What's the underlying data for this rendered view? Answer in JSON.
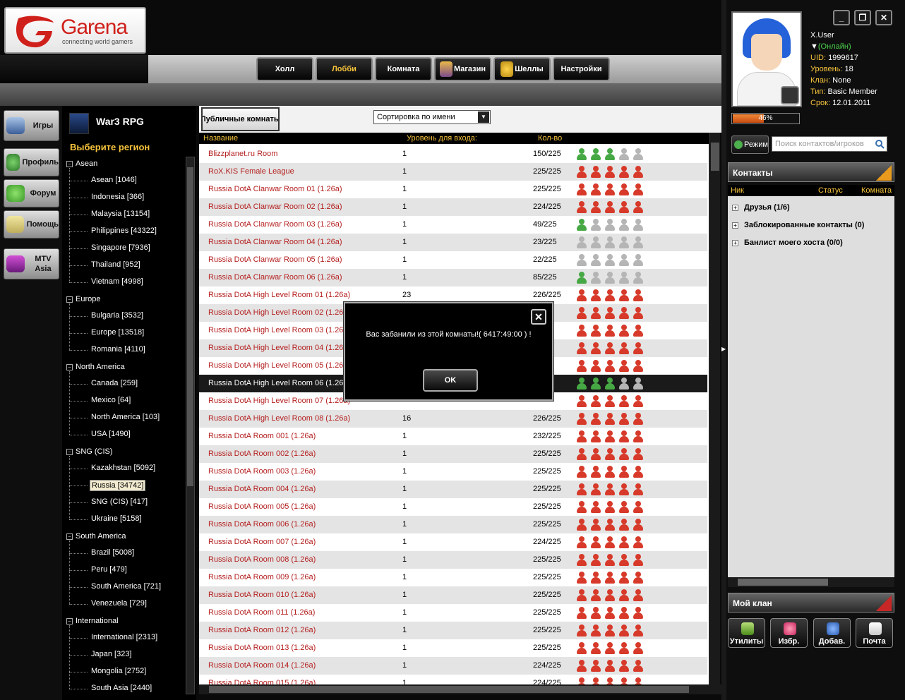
{
  "brand": {
    "name": "Garena",
    "tagline": "connecting world gamers"
  },
  "nav": [
    {
      "label": "Холл",
      "icon": null,
      "active": false
    },
    {
      "label": "Лобби",
      "icon": null,
      "active": true
    },
    {
      "label": "Комната",
      "icon": null,
      "active": false
    },
    {
      "label": "Магазин",
      "icon": "shop-icon",
      "active": false
    },
    {
      "label": "Шеллы",
      "icon": "shells-icon",
      "active": false
    },
    {
      "label": "Настройки",
      "icon": null,
      "active": false
    }
  ],
  "leftnav": [
    {
      "label": "Игры",
      "icon": "gamepad-icon"
    },
    {
      "label": "Профиль",
      "icon": "profile-icon"
    },
    {
      "label": "Форум",
      "icon": "forum-icon"
    },
    {
      "label": "Помощь",
      "icon": "help-icon"
    },
    {
      "label": "MTV Asia",
      "icon": "mtv-icon"
    }
  ],
  "game": {
    "name": "War3 RPG",
    "region_header": "Выберите регион"
  },
  "regions": [
    {
      "group": "Asean",
      "items": [
        "Asean [1046]",
        "Indonesia [366]",
        "Malaysia [13154]",
        "Philippines [43322]",
        "Singapore [7936]",
        "Thailand [952]",
        "Vietnam [4998]"
      ]
    },
    {
      "group": "Europe",
      "items": [
        "Bulgaria [3532]",
        "Europe [13518]",
        "Romania [4110]"
      ]
    },
    {
      "group": "North America",
      "items": [
        "Canada [259]",
        "Mexico [64]",
        "North America [103]",
        "USA [1490]"
      ]
    },
    {
      "group": "SNG (CIS)",
      "items": [
        "Kazakhstan [5092]",
        "Russia [34742]",
        "SNG (CIS) [417]",
        "Ukraine [5158]"
      ]
    },
    {
      "group": "South America",
      "items": [
        "Brazil [5008]",
        "Peru [479]",
        "South America [721]",
        "Venezuela [729]"
      ]
    },
    {
      "group": "International",
      "items": [
        "International [2313]",
        "Japan [323]",
        "Mongolia [2752]",
        "South Asia [2440]"
      ]
    }
  ],
  "selected_region": "Russia [34742]",
  "main": {
    "tab_label": "Публичные комнаты",
    "sort_label": "Сортировка по имени",
    "columns": {
      "name": "Название",
      "level": "Уровень для входа:",
      "count": "Кол-во"
    }
  },
  "rooms": [
    {
      "name": "Blizzplanet.ru Room",
      "level": "1",
      "count": "150/225",
      "icons": "ggg ww"
    },
    {
      "name": "RoX.KIS Female League",
      "level": "1",
      "count": "225/225",
      "icons": "rrrrr"
    },
    {
      "name": "Russia DotA Clanwar Room 01 (1.26a)",
      "level": "1",
      "count": "225/225",
      "icons": "rrrrr"
    },
    {
      "name": "Russia DotA Clanwar Room 02 (1.26a)",
      "level": "1",
      "count": "224/225",
      "icons": "rrrrr"
    },
    {
      "name": "Russia DotA Clanwar Room 03 (1.26a)",
      "level": "1",
      "count": "49/225",
      "icons": "gwwww"
    },
    {
      "name": "Russia DotA Clanwar Room 04 (1.26a)",
      "level": "1",
      "count": "23/225",
      "icons": "wwwww"
    },
    {
      "name": "Russia DotA Clanwar Room 05 (1.26a)",
      "level": "1",
      "count": "22/225",
      "icons": "wwwww"
    },
    {
      "name": "Russia DotA Clanwar Room 06 (1.26a)",
      "level": "1",
      "count": "85/225",
      "icons": "gwwww"
    },
    {
      "name": "Russia DotA High Level Room 01 (1.26a)",
      "level": "23",
      "count": "226/225",
      "icons": "rrrrr"
    },
    {
      "name": "Russia DotA High Level Room 02 (1.26a)",
      "level": "",
      "count": "",
      "icons": "rrrrr"
    },
    {
      "name": "Russia DotA High Level Room 03 (1.26a)",
      "level": "",
      "count": "",
      "icons": "rrrrr"
    },
    {
      "name": "Russia DotA High Level Room 04 (1.26a)",
      "level": "",
      "count": "",
      "icons": "rrrrr"
    },
    {
      "name": "Russia DotA High Level Room 05 (1.26a)",
      "level": "",
      "count": "",
      "icons": "rrrrr"
    },
    {
      "name": "Russia DotA High Level Room 06 (1.26a)",
      "level": "",
      "count": "",
      "icons": "gggww"
    },
    {
      "name": "Russia DotA High Level Room 07 (1.26a)",
      "level": "",
      "count": "",
      "icons": "rrrrr"
    },
    {
      "name": "Russia DotA High Level Room 08 (1.26a)",
      "level": "16",
      "count": "226/225",
      "icons": "rrrrr"
    },
    {
      "name": "Russia DotA Room 001 (1.26a)",
      "level": "1",
      "count": "232/225",
      "icons": "rrrrr"
    },
    {
      "name": "Russia DotA Room 002 (1.26a)",
      "level": "1",
      "count": "225/225",
      "icons": "rrrrr"
    },
    {
      "name": "Russia DotA Room 003 (1.26a)",
      "level": "1",
      "count": "225/225",
      "icons": "rrrrr"
    },
    {
      "name": "Russia DotA Room 004 (1.26a)",
      "level": "1",
      "count": "225/225",
      "icons": "rrrrr"
    },
    {
      "name": "Russia DotA Room 005 (1.26a)",
      "level": "1",
      "count": "225/225",
      "icons": "rrrrr"
    },
    {
      "name": "Russia DotA Room 006 (1.26a)",
      "level": "1",
      "count": "225/225",
      "icons": "rrrrr"
    },
    {
      "name": "Russia DotA Room 007 (1.26a)",
      "level": "1",
      "count": "224/225",
      "icons": "rrrrr"
    },
    {
      "name": "Russia DotA Room 008 (1.26a)",
      "level": "1",
      "count": "225/225",
      "icons": "rrrrr"
    },
    {
      "name": "Russia DotA Room 009 (1.26a)",
      "level": "1",
      "count": "225/225",
      "icons": "rrrrr"
    },
    {
      "name": "Russia DotA Room 010 (1.26a)",
      "level": "1",
      "count": "225/225",
      "icons": "rrrrr"
    },
    {
      "name": "Russia DotA Room 011 (1.26a)",
      "level": "1",
      "count": "225/225",
      "icons": "rrrrr"
    },
    {
      "name": "Russia DotA Room 012 (1.26a)",
      "level": "1",
      "count": "225/225",
      "icons": "rrrrr"
    },
    {
      "name": "Russia DotA Room 013 (1.26a)",
      "level": "1",
      "count": "225/225",
      "icons": "rrrrr"
    },
    {
      "name": "Russia DotA Room 014 (1.26a)",
      "level": "1",
      "count": "224/225",
      "icons": "rrrrr"
    },
    {
      "name": "Russia DotA Room 015 (1.26a)",
      "level": "1",
      "count": "224/225",
      "icons": "rrrrr"
    }
  ],
  "selected_room": "Russia DotA High Level Room 06 (1.26a)",
  "modal": {
    "message": "Вас забанили из этой комнаты!( 6417:49:00 ) !",
    "ok_label": "OK"
  },
  "user": {
    "name": "X.User",
    "status": "(Онлайн)",
    "uid_label": "UID:",
    "uid": "1999617",
    "level_label": "Уровень:",
    "level": "18",
    "clan_label": "Клан:",
    "clan": "None",
    "type_label": "Тип:",
    "type": "Basic Member",
    "expiry_label": "Срок:",
    "expiry": "12.01.2011",
    "xp_percent": 46,
    "xp_label": "46%"
  },
  "contacts": {
    "mode_label": "Режим",
    "search_placeholder": "Поиск контактов/игроков",
    "header": "Контакты",
    "col_nick": "Ник",
    "col_status": "Статус",
    "col_room": "Комната",
    "groups": [
      "Друзья (1/6)",
      "Заблокированные контакты (0)",
      "Банлист моего хоста (0/0)"
    ]
  },
  "clan_header": "Мой клан",
  "bottom_buttons": [
    {
      "label": "Утилиты",
      "icon": "utilities-icon"
    },
    {
      "label": "Избр.",
      "icon": "favorites-icon"
    },
    {
      "label": "Добав.",
      "icon": "add-contact-icon"
    },
    {
      "label": "Почта",
      "icon": "mail-icon"
    }
  ],
  "colors": {
    "accent": "#f6c33b",
    "room_text": "#b52020",
    "online": "#4cd24c"
  }
}
